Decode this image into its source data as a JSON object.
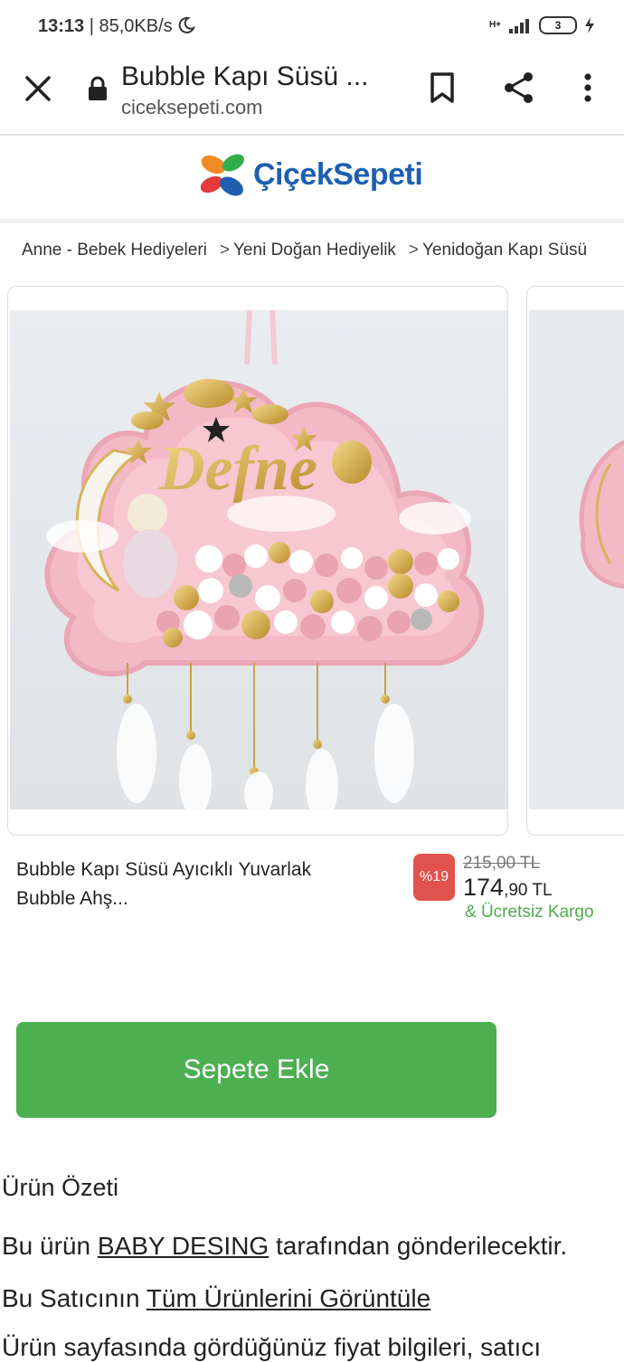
{
  "status": {
    "time": "13:13",
    "speed": "| 85,0KB/s",
    "network": "H+",
    "battery": "3"
  },
  "browser": {
    "title": "Bubble Kapı Süsü ...",
    "url": "ciceksepeti.com"
  },
  "logo": {
    "text": "ÇiçekSepeti"
  },
  "breadcrumb": [
    {
      "label": "Anne - Bebek Hediyeleri"
    },
    {
      "label": "Yeni Doğan Hediyelik"
    },
    {
      "label": "Yenidoğan Kapı Süsü"
    }
  ],
  "product": {
    "image_text": "Defne",
    "name_line1": "Bubble Kapı Süsü Ayıcıklı Yuvarlak",
    "name_line2": "Bubble Ahş...",
    "discount": "%19",
    "old_price": "215,00 TL",
    "price_main": "174",
    "price_rest": ",90 TL",
    "cargo": "& Ücretsiz Kargo",
    "cart_button": "Sepete Ekle"
  },
  "summary": {
    "title": "Ürün Özeti",
    "line1_prefix": "Bu ürün ",
    "line1_link": "BABY DESING",
    "line1_suffix": " tarafından gönderilecektir.",
    "line2_prefix": "Bu Satıcının ",
    "line2_link": "Tüm Ürünlerini Görüntüle",
    "line3": "Ürün sayfasında gördüğünüz fiyat bilgileri, satıcı"
  },
  "colors": {
    "brand_blue": "#1d5fb0",
    "cart_green": "#4caf50",
    "discount_red": "#e2524c",
    "cargo_green": "#4caa4c"
  }
}
